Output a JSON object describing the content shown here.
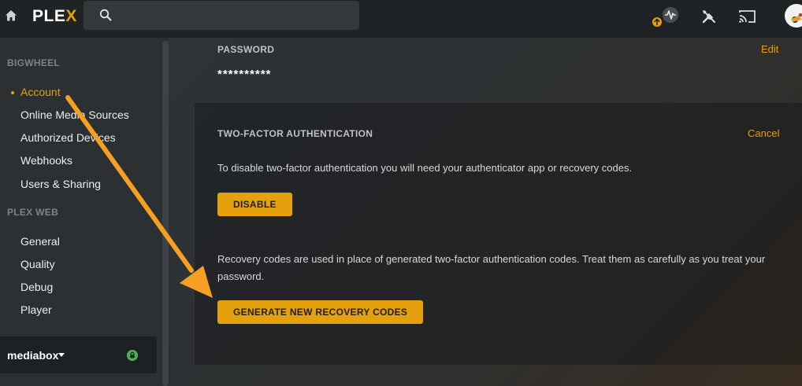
{
  "topbar": {
    "logo_main": "PLE",
    "logo_accent": "X"
  },
  "sidebar": {
    "section1_heading": "BIGWHEEL",
    "section1_items": [
      "Account",
      "Online Media Sources",
      "Authorized Devices",
      "Webhooks",
      "Users & Sharing"
    ],
    "section2_heading": "PLEX WEB",
    "section2_items": [
      "General",
      "Quality",
      "Debug",
      "Player"
    ],
    "server_name": "mediabox"
  },
  "password": {
    "label": "PASSWORD",
    "edit_label": "Edit",
    "value": "**********"
  },
  "twofa": {
    "heading": "TWO-FACTOR AUTHENTICATION",
    "cancel_label": "Cancel",
    "disable_text": "To disable two-factor authentication you will need your authenticator app or recovery codes.",
    "disable_button": "DISABLE",
    "recovery_text_line1": "Recovery codes are used in place of generated two-factor authentication codes. Treat them as carefully as you treat your",
    "recovery_text_line2": "password.",
    "generate_button": "GENERATE NEW RECOVERY CODES"
  },
  "colors": {
    "accent": "#e5a00d",
    "annotation_arrow": "#f5a023"
  },
  "icons": [
    "home-icon",
    "search-icon",
    "activity-icon",
    "update-badge-icon",
    "tools-icon",
    "cast-icon",
    "lock-icon",
    "caret-down-icon"
  ]
}
